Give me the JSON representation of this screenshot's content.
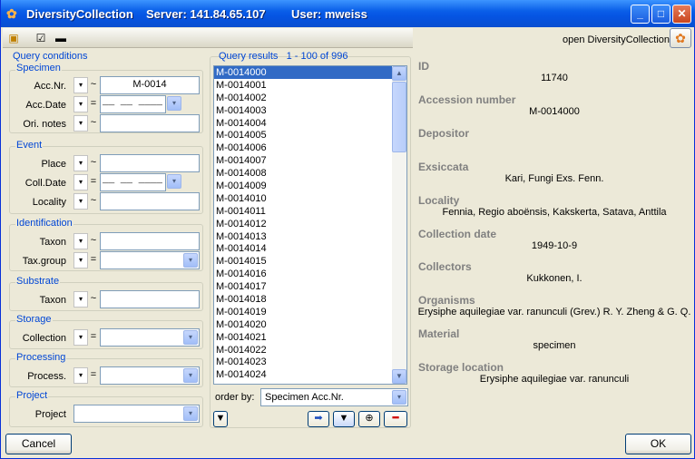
{
  "window": {
    "app": "DiversityCollection",
    "server": "Server: 141.84.65.107",
    "user": "User: mweiss",
    "minimize": "_",
    "maximize": "□",
    "close": "✕"
  },
  "toolbar": {
    "open_label": "open DiversityCollection"
  },
  "query": {
    "title": "Query conditions",
    "specimen": {
      "title": "Specimen",
      "accnr_label": "Acc.Nr.",
      "accnr_value": "M-0014",
      "accdate_label": "Acc.Date",
      "orinotes_label": "Ori. notes"
    },
    "event": {
      "title": "Event",
      "place_label": "Place",
      "colldate_label": "Coll.Date",
      "locality_label": "Locality"
    },
    "identification": {
      "title": "Identification",
      "taxon_label": "Taxon",
      "taxgroup_label": "Tax.group"
    },
    "substrate": {
      "title": "Substrate",
      "taxon_label": "Taxon"
    },
    "storage": {
      "title": "Storage",
      "collection_label": "Collection"
    },
    "processing": {
      "title": "Processing",
      "process_label": "Process."
    },
    "project": {
      "title": "Project",
      "project_label": "Project"
    },
    "ops": {
      "tilde": "~",
      "equals": "=",
      "dropdown": "▾"
    },
    "date_placeholder": "__ __ ____"
  },
  "results": {
    "title": "Query results",
    "range": "1 - 100 of 996",
    "items": [
      "M-0014000",
      "M-0014001",
      "M-0014002",
      "M-0014003",
      "M-0014004",
      "M-0014005",
      "M-0014006",
      "M-0014007",
      "M-0014008",
      "M-0014009",
      "M-0014010",
      "M-0014011",
      "M-0014012",
      "M-0014013",
      "M-0014014",
      "M-0014015",
      "M-0014016",
      "M-0014017",
      "M-0014018",
      "M-0014019",
      "M-0014020",
      "M-0014021",
      "M-0014022",
      "M-0014023",
      "M-0014024"
    ],
    "order_label": "order by:",
    "order_value": "Specimen Acc.Nr."
  },
  "details": [
    {
      "label": "ID",
      "value": "11740"
    },
    {
      "label": "Accession number",
      "value": "M-0014000"
    },
    {
      "label": "Depositor",
      "value": ""
    },
    {
      "label": "Exsiccata",
      "value": "Kari, Fungi Exs. Fenn."
    },
    {
      "label": "Locality",
      "value": "Fennia, Regio aboënsis, Kakskerta, Satava, Anttila"
    },
    {
      "label": "Collection date",
      "value": "1949-10-9"
    },
    {
      "label": "Collectors",
      "value": "Kukkonen, I."
    },
    {
      "label": "Organisms",
      "value": "Erysiphe aquilegiae var. ranunculi (Grev.) R. Y. Zheng & G. Q."
    },
    {
      "label": "Material",
      "value": "specimen"
    },
    {
      "label": "Storage location",
      "value": "Erysiphe aquilegiae var. ranunculi"
    }
  ],
  "buttons": {
    "cancel": "Cancel",
    "ok": "OK"
  }
}
